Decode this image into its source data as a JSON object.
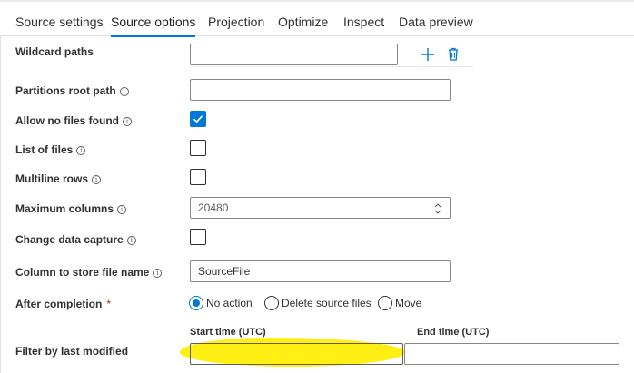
{
  "tabs": [
    {
      "label": "Source settings",
      "active": false
    },
    {
      "label": "Source options",
      "active": true
    },
    {
      "label": "Projection",
      "active": false
    },
    {
      "label": "Optimize",
      "active": false
    },
    {
      "label": "Inspect",
      "active": false
    },
    {
      "label": "Data preview",
      "active": false
    }
  ],
  "form": {
    "wildcard_paths": {
      "label": "Wildcard paths",
      "value": ""
    },
    "partitions_root_path": {
      "label": "Partitions root path",
      "value": ""
    },
    "allow_no_files_found": {
      "label": "Allow no files found",
      "checked": true
    },
    "list_of_files": {
      "label": "List of files",
      "checked": false
    },
    "multiline_rows": {
      "label": "Multiline rows",
      "checked": false
    },
    "maximum_columns": {
      "label": "Maximum columns",
      "value": "20480"
    },
    "change_data_capture": {
      "label": "Change data capture",
      "checked": false
    },
    "column_to_store_file_name": {
      "label": "Column to store file name",
      "value": "SourceFile"
    },
    "after_completion": {
      "label": "After completion",
      "required_mark": "*",
      "options": [
        "No action",
        "Delete source files",
        "Move"
      ],
      "selected": "No action"
    },
    "filter_by_last_modified": {
      "label": "Filter by last modified",
      "start_label": "Start time (UTC)",
      "end_label": "End time (UTC)",
      "start_value": "",
      "end_value": ""
    }
  },
  "icons": {
    "info": "info-icon",
    "add": "plus-icon",
    "delete": "trash-icon",
    "spin": "chevron-updown-icon"
  },
  "colors": {
    "accent": "#0078d4",
    "highlight": "#ffee00",
    "required": "#a4262c"
  }
}
